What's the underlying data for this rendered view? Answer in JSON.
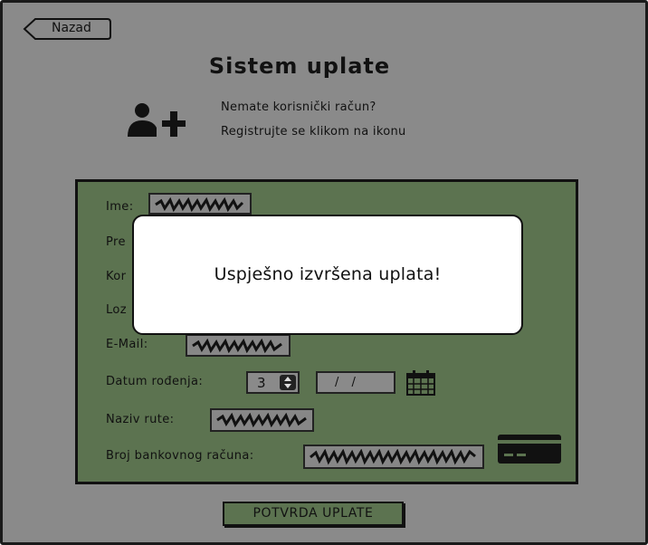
{
  "header": {
    "back_label": "Nazad",
    "title": "Sistem uplate"
  },
  "registration": {
    "icon": "add-user-icon",
    "line1": "Nemate korisnički račun?",
    "line2": "Registrujte se klikom na ikonu"
  },
  "form": {
    "labels": {
      "ime": "Ime:",
      "prezime": "Pre",
      "korisnicko": "Kor",
      "lozinka": "Loz",
      "email": "E-Mail:",
      "datum": "Datum rođenja:",
      "ruta": "Naziv rute:",
      "racun": "Broj bankovnog računa:"
    },
    "birth_day": "3",
    "birth_date": "/ /",
    "calendar_icon": "calendar-icon",
    "card_icon": "credit-card-icon"
  },
  "confirm_label": "POTVRDA UPLATE",
  "modal": {
    "message": "Uspješno izvršena uplata!"
  },
  "colors": {
    "background": "#8a8a8a",
    "panel": "#5c7350",
    "modal": "#ffffff"
  }
}
